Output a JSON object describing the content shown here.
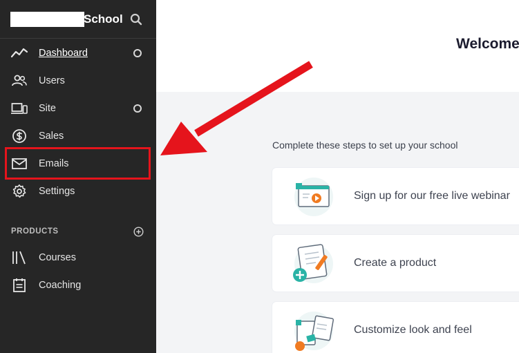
{
  "brand": {
    "name": "School",
    "search_icon": "search-icon"
  },
  "nav": [
    {
      "id": "dashboard",
      "label": "Dashboard",
      "icon": "activity-line-icon",
      "active": true,
      "status_dot": true
    },
    {
      "id": "users",
      "label": "Users",
      "icon": "users-icon",
      "active": false,
      "status_dot": false
    },
    {
      "id": "site",
      "label": "Site",
      "icon": "devices-icon",
      "active": false,
      "status_dot": true
    },
    {
      "id": "sales",
      "label": "Sales",
      "icon": "dollar-circle-icon",
      "active": false,
      "status_dot": false
    },
    {
      "id": "emails",
      "label": "Emails",
      "icon": "mail-icon",
      "active": false,
      "status_dot": false
    },
    {
      "id": "settings",
      "label": "Settings",
      "icon": "gear-icon",
      "active": false,
      "status_dot": false
    }
  ],
  "products": {
    "heading": "PRODUCTS",
    "add_icon": "plus-circle-icon",
    "items": [
      {
        "id": "courses",
        "label": "Courses",
        "icon": "library-icon"
      },
      {
        "id": "coaching",
        "label": "Coaching",
        "icon": "calendar-icon"
      }
    ]
  },
  "main": {
    "welcome": "Welcome",
    "steps_heading": "Complete these steps to set up your school",
    "steps": [
      {
        "label": "Sign up for our free live webinar",
        "icon": "webinar-illustration"
      },
      {
        "label": "Create a product",
        "icon": "create-product-illustration"
      },
      {
        "label": "Customize look and feel",
        "icon": "customize-illustration"
      }
    ]
  },
  "colors": {
    "sidebar_bg": "#262626",
    "main_bg": "#f3f4f6",
    "highlight": "#e5141c",
    "accent_teal": "#2ab3a6",
    "accent_orange": "#f07b22"
  }
}
